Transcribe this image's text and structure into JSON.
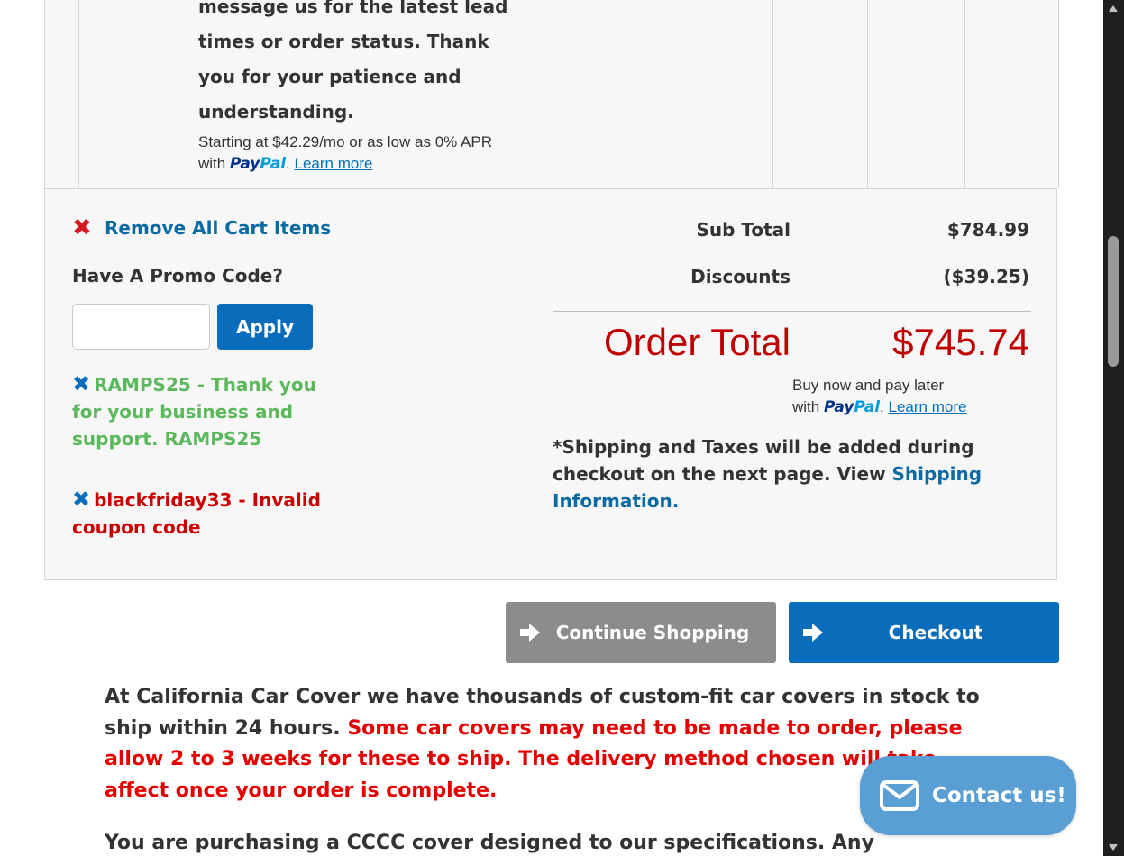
{
  "product": {
    "lead_text": "message us for the latest lead times or order status. Thank you for your patience and understanding.",
    "financing_text": "Starting at $42.29/mo or as low as 0% APR",
    "financing_with": "with",
    "paypal_pay": "Pay",
    "paypal_pal": "Pal",
    "period": ".",
    "learn_more": "Learn more"
  },
  "summary": {
    "remove_all_label": "Remove All Cart Items",
    "promo_heading": "Have A Promo Code?",
    "promo_input_value": "",
    "apply_label": "Apply",
    "coupons": [
      {
        "text": "RAMPS25 - Thank you for your business and support. RAMPS25",
        "status": "valid",
        "color": "#5cb85c"
      },
      {
        "text": "blackfriday33 - Invalid coupon code",
        "status": "invalid",
        "color": "#cc0000"
      }
    ],
    "subtotal_label": "Sub Total",
    "subtotal_value": "$784.99",
    "discounts_label": "Discounts",
    "discounts_value": "($39.25)",
    "order_total_label": "Order Total",
    "order_total_value": "$745.74",
    "paylater_line1": "Buy now and pay later",
    "paylater_with": "with",
    "paylater_learn_more": "Learn more",
    "shipping_note": "*Shipping and Taxes will be added during checkout on the next page.  View",
    "shipping_link": "Shipping Information."
  },
  "actions": {
    "continue_label": "Continue Shopping",
    "checkout_label": "Checkout"
  },
  "info": {
    "para1_normal": "At California Car Cover we have thousands of custom-fit car covers in stock to ship within 24 hours.",
    "para1_red": "Some car covers may need to be made to order, please allow 2 to 3 weeks for these to ship. The delivery method chosen will take affect once your order is complete.",
    "para2": "You are purchasing a CCCC cover designed to our specifications. Any requested"
  },
  "contact": {
    "label": "Contact us!",
    "icon": "envelope-icon"
  },
  "colors": {
    "accent_blue": "#0a6dbb",
    "link_blue": "#0a6aa1",
    "order_total_red": "#c00000",
    "valid_green": "#5cb85c",
    "invalid_red": "#cc0000",
    "contact_bubble": "#5a9fd3"
  }
}
